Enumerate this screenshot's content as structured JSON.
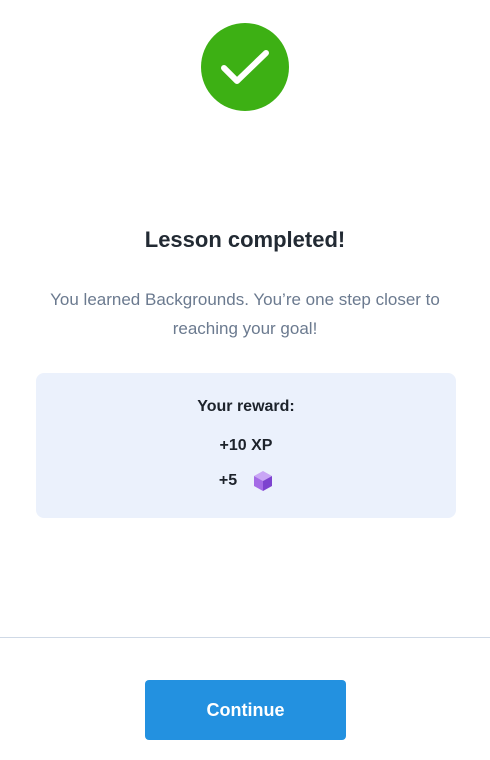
{
  "status": {
    "icon": "checkmark-icon",
    "color": "#3db014"
  },
  "title": "Lesson completed!",
  "message": "You learned Backgrounds. You’re one step closer to reaching your goal!",
  "reward": {
    "heading": "Your reward:",
    "xp": "+10 XP",
    "gems": "+5",
    "gem_icon": "purple-cube-icon",
    "card_color": "#ebf1fc"
  },
  "footer": {
    "continue_label": "Continue",
    "button_color": "#2391e0"
  }
}
